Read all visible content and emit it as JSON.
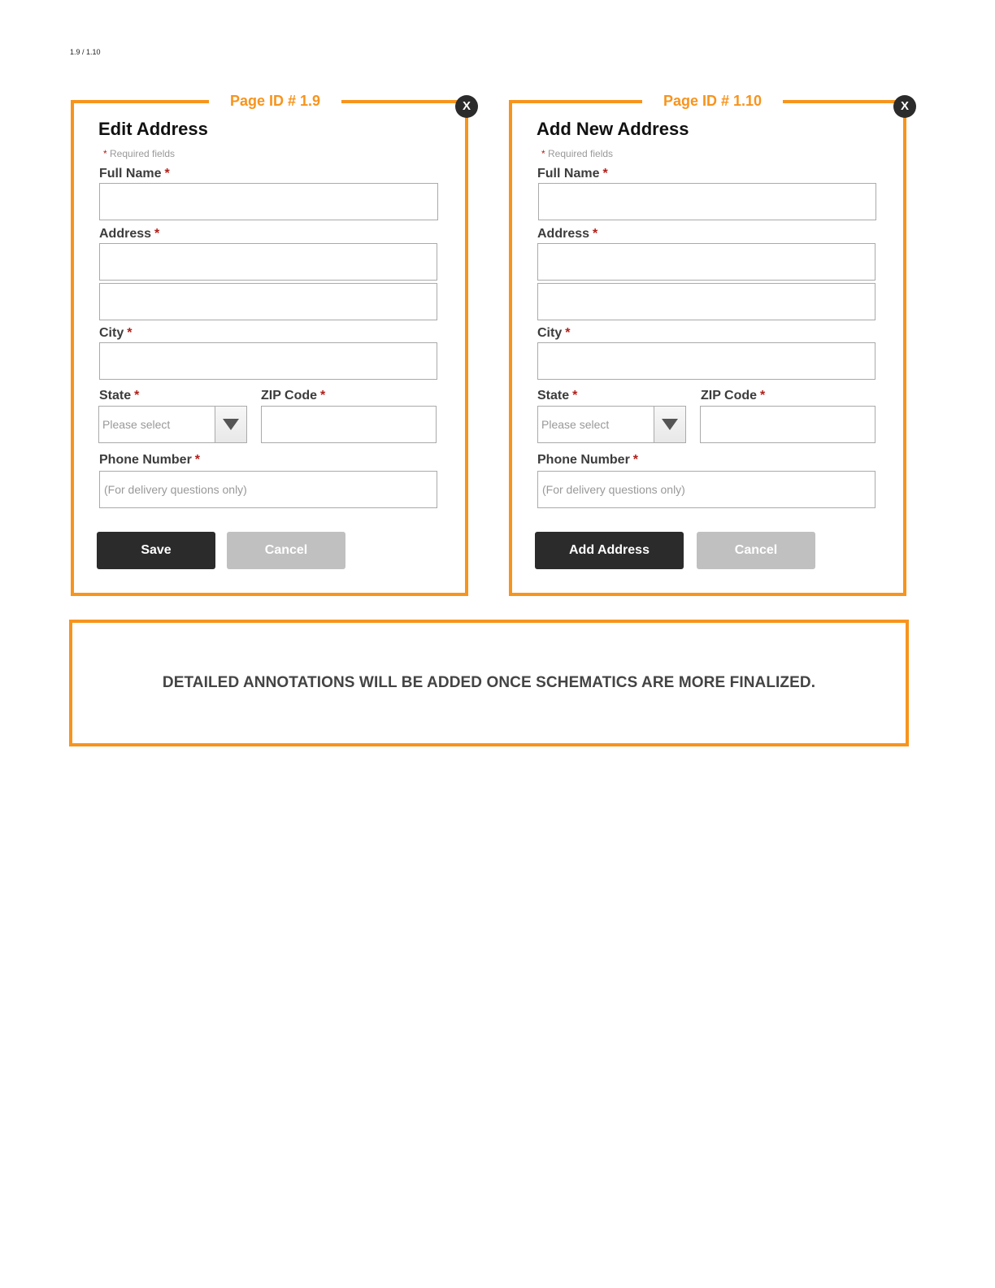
{
  "page_ref": "1.9  / 1.10",
  "required_marker": "*",
  "colors": {
    "frame_accent": "#f7941d",
    "required_star": "#b0201a",
    "primary_button": "#2b2b2b",
    "secondary_button": "#c0c0c0"
  },
  "forms": [
    {
      "page_id": "Page ID # 1.9",
      "close_label": "X",
      "title": "Edit Address",
      "required_note": "Required fields",
      "labels": {
        "full_name": "Full Name",
        "address": "Address",
        "city": "City",
        "state": "State",
        "zip": "ZIP Code",
        "phone": "Phone Number"
      },
      "fields": {
        "full_name_value": "",
        "address_line1_value": "",
        "address_line2_value": "",
        "city_value": "",
        "state_selected": "Please select",
        "zip_value": "",
        "phone_placeholder": "(For delivery questions only)"
      },
      "primary_button": "Save",
      "secondary_button": "Cancel"
    },
    {
      "page_id": "Page ID # 1.10",
      "close_label": "X",
      "title": "Add New Address",
      "required_note": "Required fields",
      "labels": {
        "full_name": "Full Name",
        "address": "Address",
        "city": "City",
        "state": "State",
        "zip": "ZIP Code",
        "phone": "Phone Number"
      },
      "fields": {
        "full_name_value": "",
        "address_line1_value": "",
        "address_line2_value": "",
        "city_value": "",
        "state_selected": "Please select",
        "zip_value": "",
        "phone_placeholder": "(For delivery questions only)"
      },
      "primary_button": "Add Address",
      "secondary_button": "Cancel"
    }
  ],
  "annotation": "DETAILED ANNOTATIONS WILL BE ADDED ONCE SCHEMATICS ARE MORE FINALIZED."
}
